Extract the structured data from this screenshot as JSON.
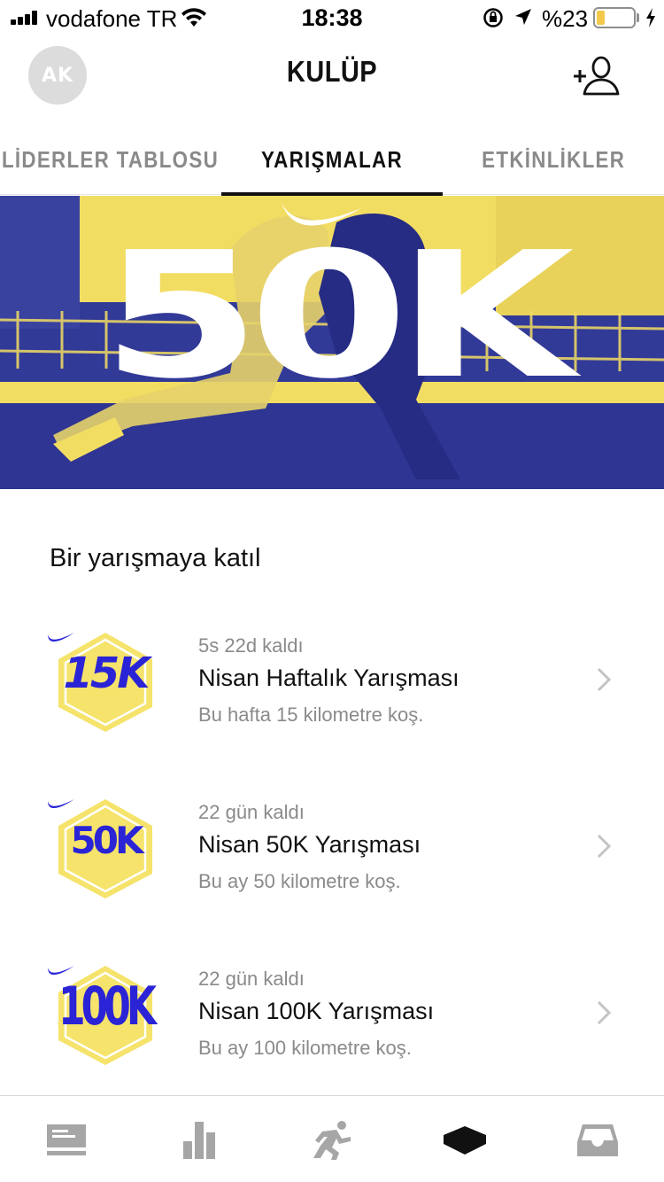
{
  "status_bar": {
    "carrier": "vodafone TR",
    "time": "18:38",
    "battery_text": "%23",
    "battery_level": 0.23,
    "battery_color": "#f2c94c"
  },
  "header": {
    "avatar_initials": "AK",
    "title": "KULÜP",
    "add_friend_icon": "add-friend-icon"
  },
  "tabs": [
    {
      "label": "LİDERLER TABLOSU",
      "active": false
    },
    {
      "label": "YARIŞMALAR",
      "active": true
    },
    {
      "label": "ETKİNLİKLER",
      "active": false
    }
  ],
  "hero": {
    "label": "50K",
    "colors": {
      "yellow": "#f2dd63",
      "blue": "#323a98"
    }
  },
  "section": {
    "title": "Bir yarışmaya katıl"
  },
  "challenges": [
    {
      "badge": "15K",
      "remaining": "5s 22d kaldı",
      "title": "Nisan Haftalık Yarışması",
      "description": "Bu hafta 15 kilometre koş."
    },
    {
      "badge": "50K",
      "remaining": "22 gün kaldı",
      "title": "Nisan 50K Yarışması",
      "description": "Bu ay 50 kilometre koş."
    },
    {
      "badge": "100K",
      "remaining": "22 gün kaldı",
      "title": "Nisan 100K Yarışması",
      "description": "Bu ay 100 kilometre koş."
    }
  ],
  "tabbar": {
    "items": [
      {
        "icon": "feed-icon",
        "active": false
      },
      {
        "icon": "activity-bars-icon",
        "active": false
      },
      {
        "icon": "runner-icon",
        "active": false
      },
      {
        "icon": "club-icon",
        "active": true
      },
      {
        "icon": "inbox-icon",
        "active": false
      }
    ]
  },
  "theme": {
    "badge_yellow": "#f5e36b",
    "badge_blue": "#2a24d6",
    "muted_text": "#8a8a8a",
    "tabbar_icon": "#a6a6a6"
  }
}
